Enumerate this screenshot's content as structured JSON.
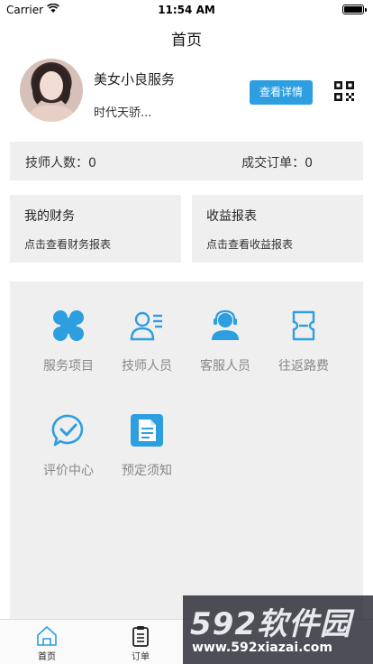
{
  "status_bar": {
    "carrier": "Carrier",
    "time": "11:54 AM"
  },
  "nav": {
    "title": "首页"
  },
  "profile": {
    "name": "美女小良服务",
    "description": "时代天骄...",
    "detail_button": "查看详情"
  },
  "stats": {
    "technicians": "技师人数：0",
    "orders": "成交订单：0"
  },
  "cards": [
    {
      "title": "我的财务",
      "subtitle": "点击查看财务报表"
    },
    {
      "title": "收益报表",
      "subtitle": "点击查看收益报表"
    }
  ],
  "grid": [
    {
      "label": "服务项目",
      "icon": "service-items-icon"
    },
    {
      "label": "技师人员",
      "icon": "technician-icon"
    },
    {
      "label": "客服人员",
      "icon": "customer-service-icon"
    },
    {
      "label": "往返路费",
      "icon": "travel-fee-icon"
    },
    {
      "label": "评价中心",
      "icon": "review-icon"
    },
    {
      "label": "预定须知",
      "icon": "booking-notice-icon"
    }
  ],
  "tabbar": [
    {
      "label": "首页",
      "icon": "home-icon"
    },
    {
      "label": "订单",
      "icon": "orders-icon"
    }
  ],
  "watermark": {
    "brand": "592软件园",
    "url": "www.592xiazai.com"
  },
  "colors": {
    "accent": "#2d9ee0",
    "panel": "#efefef",
    "label_gray": "#888888"
  }
}
